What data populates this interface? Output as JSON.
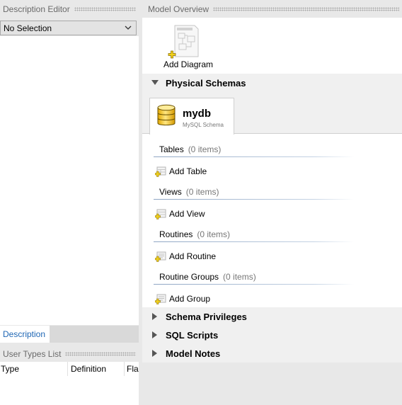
{
  "description_editor": {
    "title": "Description Editor",
    "dropdown_value": "No Selection",
    "tab_label": "Description"
  },
  "user_types": {
    "title": "User Types List",
    "columns": [
      "Type",
      "Definition",
      "Flags"
    ]
  },
  "model_overview": {
    "title": "Model Overview",
    "add_diagram_label": "Add Diagram",
    "physical_schemas": {
      "label": "Physical Schemas",
      "schema_name": "mydb",
      "schema_type": "MySQL Schema",
      "groups": [
        {
          "title": "Tables",
          "count": "(0 items)",
          "add_label": "Add Table"
        },
        {
          "title": "Views",
          "count": "(0 items)",
          "add_label": "Add View"
        },
        {
          "title": "Routines",
          "count": "(0 items)",
          "add_label": "Add Routine"
        },
        {
          "title": "Routine Groups",
          "count": "(0 items)",
          "add_label": "Add Group"
        }
      ]
    },
    "sections": [
      {
        "label": "Schema Privileges"
      },
      {
        "label": "SQL Scripts"
      },
      {
        "label": "Model Notes"
      }
    ]
  },
  "icons": {
    "chevron": "chevron-down-icon",
    "expanded": "triangle-down-icon",
    "collapsed": "triangle-right-icon",
    "diagram": "diagram-icon",
    "database": "database-icon",
    "add": "add-icon"
  },
  "colors": {
    "accent": "#1e66b4",
    "panel_bg": "#e8e8e8",
    "header_text": "#6a6a6a"
  }
}
